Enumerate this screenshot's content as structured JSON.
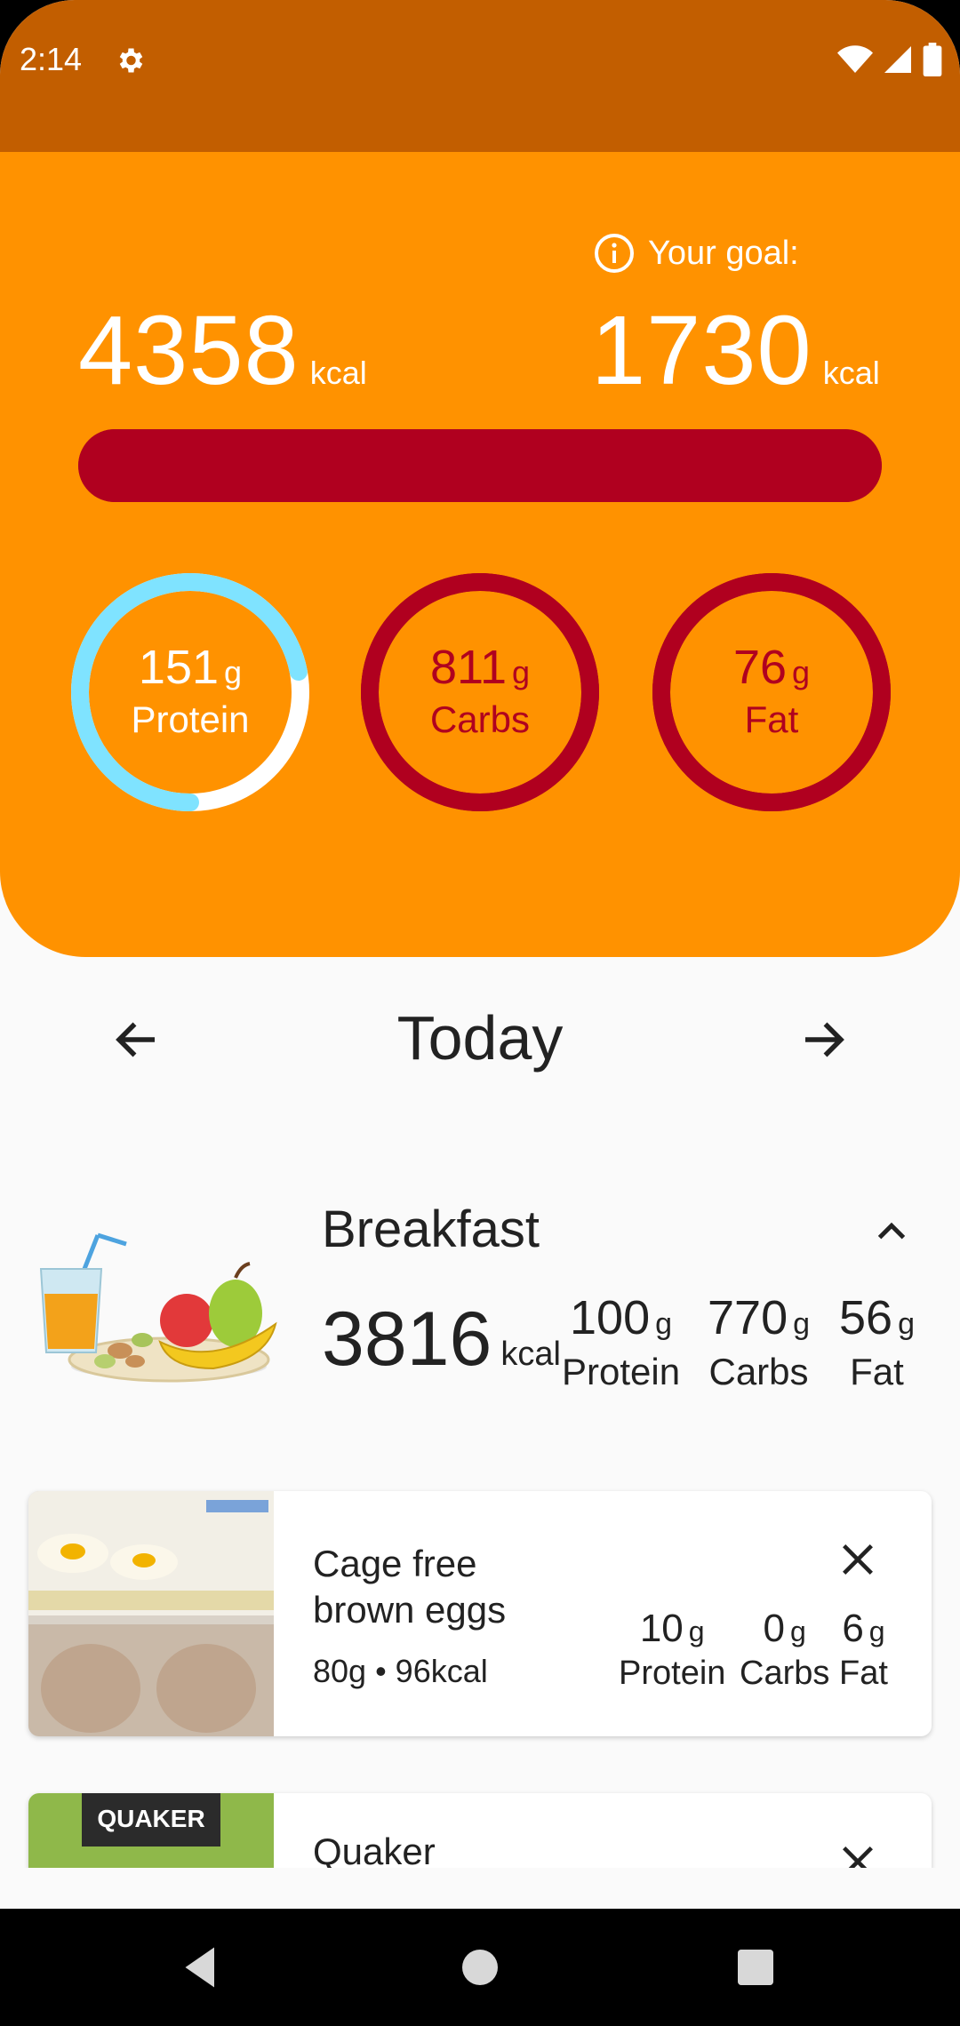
{
  "status_bar": {
    "time": "2:14"
  },
  "summary": {
    "eaten_value": "4358",
    "eaten_unit": "kcal",
    "goal_label": "Your goal:",
    "goal_value": "1730",
    "goal_unit": "kcal",
    "progress_fraction": 1.0,
    "macros": [
      {
        "value": "151",
        "unit": "g",
        "name": "Protein",
        "ring_fraction": 0.72,
        "ring_color": "#7fe3ff",
        "track_color": "#ffffff"
      },
      {
        "value": "811",
        "unit": "g",
        "name": "Carbs",
        "ring_fraction": 1.0,
        "ring_color": "#b0001f",
        "track_color": "#b0001f"
      },
      {
        "value": "76",
        "unit": "g",
        "name": "Fat",
        "ring_fraction": 1.0,
        "ring_color": "#b0001f",
        "track_color": "#b0001f"
      }
    ]
  },
  "date_nav": {
    "title": "Today"
  },
  "meal": {
    "title": "Breakfast",
    "kcal_value": "3816",
    "kcal_unit": "kcal",
    "macros": [
      {
        "value": "100",
        "unit": "g",
        "name": "Protein"
      },
      {
        "value": "770",
        "unit": "g",
        "name": "Carbs"
      },
      {
        "value": "56",
        "unit": "g",
        "name": "Fat"
      }
    ]
  },
  "foods": [
    {
      "name": "Cage free brown eggs",
      "detail": "80g • 96kcal",
      "macros": [
        {
          "value": "10",
          "unit": "g",
          "name": "Protein"
        },
        {
          "value": "0",
          "unit": "g",
          "name": "Carbs"
        },
        {
          "value": "6",
          "unit": "g",
          "name": "Fat"
        }
      ]
    },
    {
      "name": "Quaker",
      "image_text": "QUAKER"
    }
  ],
  "colors": {
    "status_bar": "#c25e00",
    "header": "#ff9200",
    "progress_over": "#b0001f",
    "protein_ring": "#7fe3ff"
  }
}
